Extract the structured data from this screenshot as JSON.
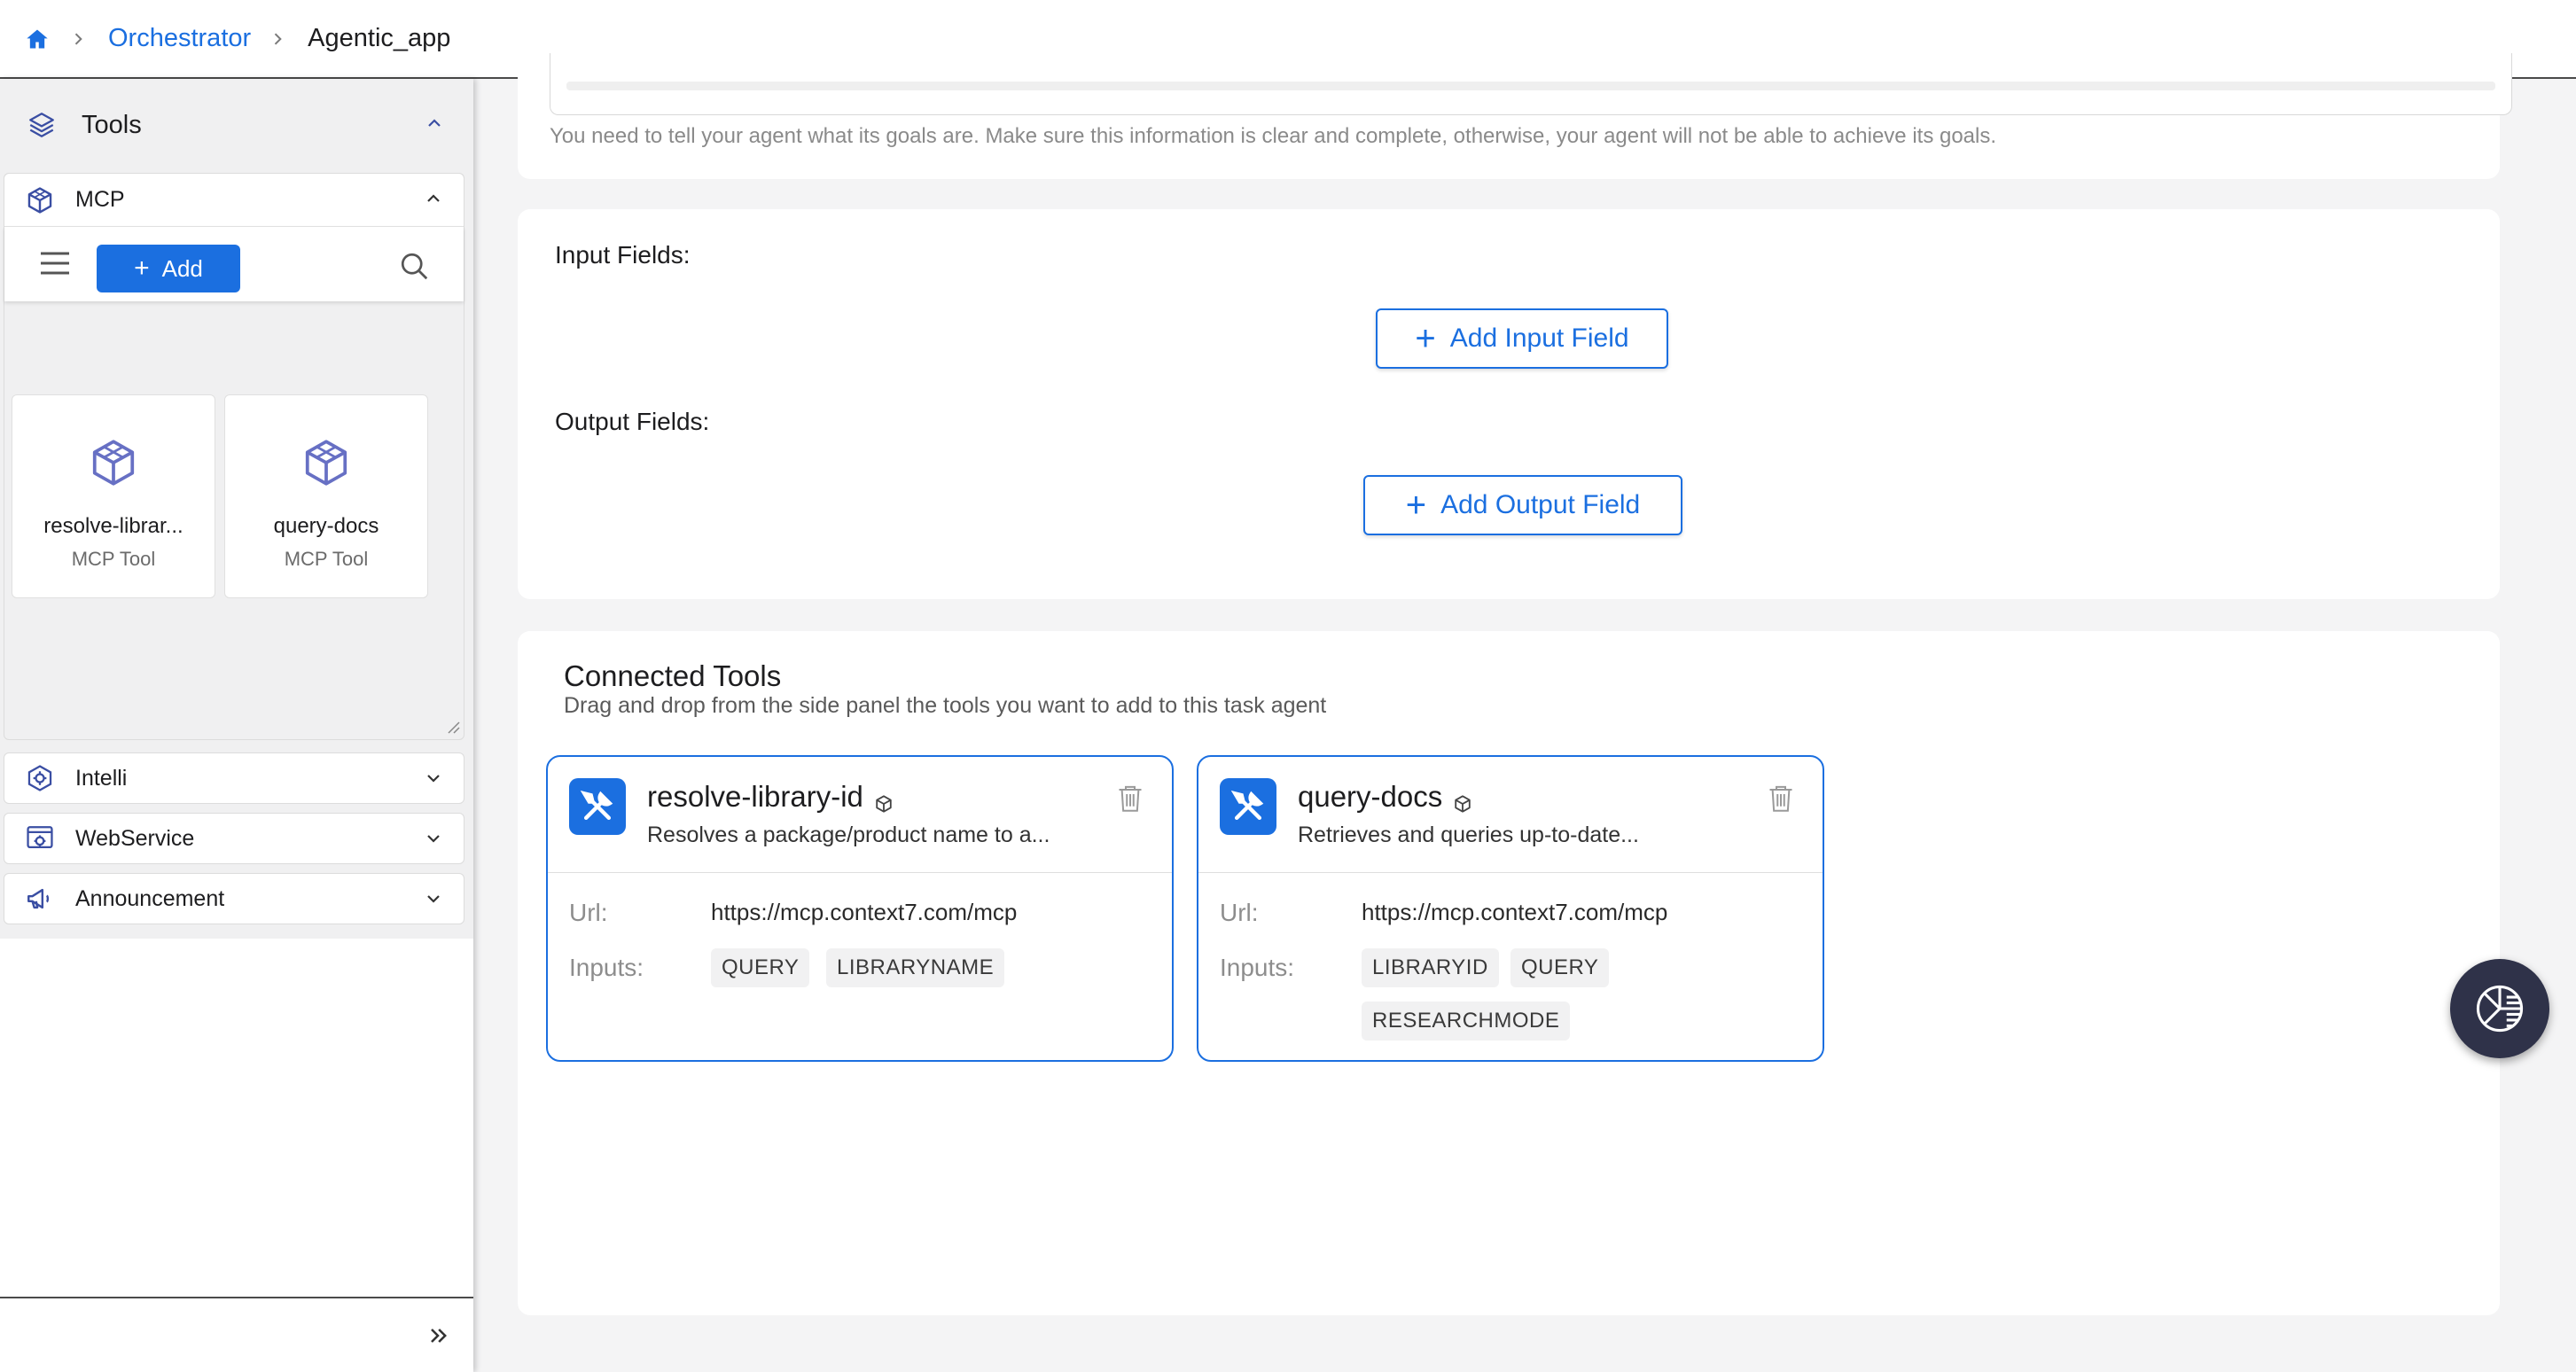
{
  "breadcrumb": {
    "home_icon": "home-icon",
    "items": [
      "Orchestrator",
      "Agentic_app"
    ]
  },
  "sidebar": {
    "title": "Tools",
    "sections": {
      "mcp": {
        "label": "MCP",
        "add_label": "Add",
        "tools": [
          {
            "name": "resolve-librar...",
            "type": "MCP Tool"
          },
          {
            "name": "query-docs",
            "type": "MCP Tool"
          }
        ]
      },
      "collapsed": [
        {
          "label": "Intelli",
          "icon": "gear-hex-icon"
        },
        {
          "label": "WebService",
          "icon": "webservice-icon"
        },
        {
          "label": "Announcement",
          "icon": "megaphone-icon"
        }
      ]
    }
  },
  "goals": {
    "hint": "You need to tell your agent what its goals are. Make sure this information is clear and complete, otherwise, your agent will not be able to achieve its goals."
  },
  "fields": {
    "input_label": "Input Fields:",
    "add_input_label": "Add Input Field",
    "output_label": "Output Fields:",
    "add_output_label": "Add Output Field"
  },
  "connected_tools": {
    "title": "Connected Tools",
    "subtitle": "Drag and drop from the side panel the tools you want to add to this task agent",
    "url_key": "Url:",
    "inputs_key": "Inputs:",
    "tools": [
      {
        "name": "resolve-library-id",
        "description": "Resolves a package/product name to a...",
        "url": "https://mcp.context7.com/mcp",
        "inputs": [
          "QUERY",
          "LIBRARYNAME"
        ]
      },
      {
        "name": "query-docs",
        "description": "Retrieves and queries up-to-date...",
        "url": "https://mcp.context7.com/mcp",
        "inputs": [
          "LIBRARYID",
          "QUERY",
          "RESEARCHMODE"
        ]
      }
    ]
  },
  "colors": {
    "accent": "#1b6fe0",
    "icon_purple": "#6770c4",
    "fab": "#2f3249"
  }
}
